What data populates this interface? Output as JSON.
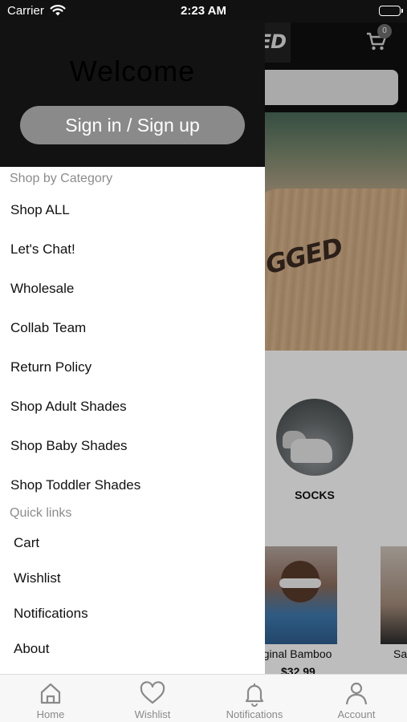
{
  "status_bar": {
    "carrier": "Carrier",
    "time": "2:23 AM",
    "icons": [
      "wifi-icon",
      "battery-icon"
    ]
  },
  "background_app": {
    "logo_text": "ED",
    "cart_count": "0",
    "hero_brand_text": "GGED",
    "category": {
      "label": "SOCKS"
    },
    "products": [
      {
        "title": "riginal Bamboo",
        "price": "$32.99"
      },
      {
        "title": "Sa"
      }
    ]
  },
  "drawer": {
    "welcome": "Welcome",
    "signin_label": "Sign in / Sign up",
    "shop_section_title": "Shop by Category",
    "categories": [
      "Shop ALL",
      "Let's Chat!",
      "Wholesale",
      "Collab Team",
      "Return Policy",
      "Shop Adult Shades",
      "Shop Baby Shades",
      "Shop Toddler Shades"
    ],
    "quick_section_title": "Quick links",
    "quick_links": [
      "Cart",
      "Wishlist",
      "Notifications",
      "About"
    ]
  },
  "tab_bar": {
    "tabs": [
      {
        "label": "Home",
        "icon": "home-icon"
      },
      {
        "label": "Wishlist",
        "icon": "heart-icon"
      },
      {
        "label": "Notifications",
        "icon": "bell-icon"
      },
      {
        "label": "Account",
        "icon": "person-icon"
      }
    ]
  },
  "colors": {
    "drawer_header": "#121212",
    "signin_button": "#8a8a8a",
    "section_title": "#8c8c8c",
    "tab_inactive": "#8a8a8a"
  }
}
